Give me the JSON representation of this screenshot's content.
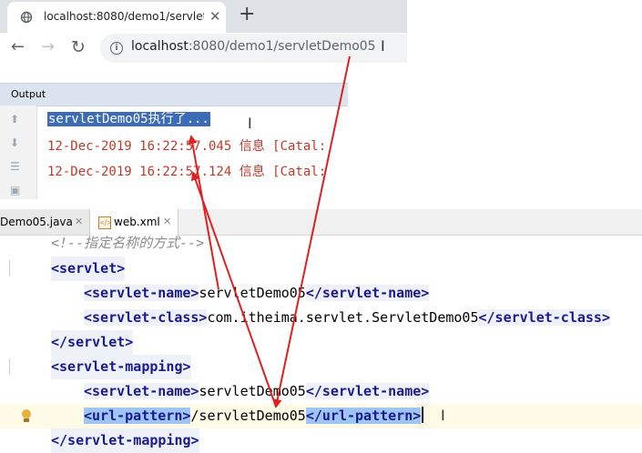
{
  "browser": {
    "tab_title": "localhost:8080/demo1/servletI",
    "tab_close": "✕",
    "new_tab": "+",
    "url_host": "localhost",
    "url_rest": ":8080/demo1/servletDemo05",
    "back_icon": "←",
    "forward_icon": "→",
    "reload_icon": "↻"
  },
  "output": {
    "title": "Output",
    "lines": [
      "servletDemo05执行了...",
      "12-Dec-2019 16:22:57.045 信息 [Catal:",
      "12-Dec-2019 16:22:57.124 信息 [Catal:"
    ]
  },
  "editor": {
    "tabs": [
      {
        "label": "Demo05.java",
        "close": "✕"
      },
      {
        "label": "web.xml",
        "close": "✕"
      }
    ],
    "code": {
      "comment": "<!--指定名称的方式-->",
      "servlet_open": "<servlet>",
      "name_open": "<servlet-name>",
      "name_value": "servletDemo05",
      "name_close": "</servlet-name>",
      "class_open": "<servlet-class>",
      "class_value": "com.itheima.servlet.ServletDemo05",
      "class_close": "</servlet-class>",
      "servlet_close": "</servlet>",
      "mapping_open": "<servlet-mapping>",
      "map_name_open": "<servlet-name>",
      "map_name_value": "servletDemo05",
      "map_name_close": "</servlet-name>",
      "url_open": "<url-pattern>",
      "url_value": "/servletDemo05",
      "url_close": "</url-pattern>",
      "mapping_close": "</servlet-mapping>"
    }
  },
  "colors": {
    "arrow": "#e02020",
    "selection": "#3c6bb8",
    "tag_highlight": "#9fc5f5",
    "log_red": "#c0392b"
  },
  "icons": [
    "globe-icon",
    "info-icon",
    "xml-file-icon",
    "lightbulb-icon",
    "text-cursor-icon"
  ]
}
